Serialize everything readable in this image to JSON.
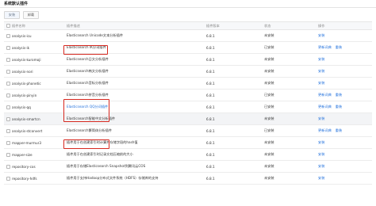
{
  "page": {
    "title": "系统默认插件"
  },
  "toolbar": {
    "install_label": "安装",
    "uninstall_label": "卸载"
  },
  "table": {
    "headers": {
      "name": "插件名称",
      "description": "插件描述",
      "version": "插件版本",
      "status": "状态",
      "actions": "操作"
    },
    "rows": [
      {
        "name": "analysis-icu",
        "description": "Elasticsearch Unicode文本分析插件",
        "version": "6.8.1",
        "status": "未安装",
        "actions": [
          "安装"
        ]
      },
      {
        "name": "analysis-ik",
        "description": "Elasticsearch IK分词插件",
        "version": "6.8.1",
        "status": "已安装",
        "actions": [
          "更新词典",
          "重装"
        ]
      },
      {
        "name": "analysis-kuromoji",
        "description": "Elasticsearch日文分析插件",
        "version": "6.8.1",
        "status": "未安装",
        "actions": [
          "安装"
        ]
      },
      {
        "name": "analysis-nori",
        "description": "Elasticsearch韩文分析插件",
        "version": "6.8.1",
        "status": "未安装",
        "actions": [
          "安装"
        ]
      },
      {
        "name": "analysis-phonetic",
        "description": "Elasticsearch音标分析插件",
        "version": "6.8.1",
        "status": "未安装",
        "actions": [
          "安装"
        ]
      },
      {
        "name": "analysis-pinyin",
        "description": "Elasticsearch拼音分析插件",
        "version": "6.8.1",
        "status": "已安装",
        "actions": [
          "更新词典",
          "重装"
        ]
      },
      {
        "name": "analysis-qq",
        "description": "Elasticsearch QQ分词插件",
        "version": "6.8.1",
        "status": "已安装",
        "actions": [
          "更新词典",
          "重装"
        ]
      },
      {
        "name": "analysis-smartcn",
        "description": "Elasticsearch智能中文分析插件",
        "version": "6.8.1",
        "status": "未安装",
        "actions": [
          "安装"
        ]
      },
      {
        "name": "analysis-stconvert",
        "description": "Elasticsearch繁简体分析插件",
        "version": "6.8.1",
        "status": "已安装",
        "actions": [
          "更新词典",
          "重装"
        ]
      },
      {
        "name": "mapper-murmur3",
        "description": "插件用于在创建索引时计算并存储字段的hash值",
        "version": "6.8.1",
        "status": "未安装",
        "actions": [
          "安装"
        ]
      },
      {
        "name": "mapper-size",
        "description": "插件用于在创建索引时记录文档压缩前的大小",
        "version": "6.8.1",
        "status": "未安装",
        "actions": [
          "安装"
        ]
      },
      {
        "name": "repository-cos",
        "description": "插件用于存储Elasticsearch Snapshot到腾讯云COS",
        "version": "6.8.1",
        "status": "未安装",
        "actions": [
          "安装"
        ]
      },
      {
        "name": "repository-hdfs",
        "description": "插件用于支持Hadoop分布式文件系统（HDFS）存储库的支持",
        "version": "6.8.1",
        "status": "未安装",
        "actions": [
          "安装"
        ]
      }
    ]
  },
  "colors": {
    "link": "#1f6fdc",
    "highlight_border": "#d6281f",
    "row_shaded": "#f3f4f6"
  }
}
